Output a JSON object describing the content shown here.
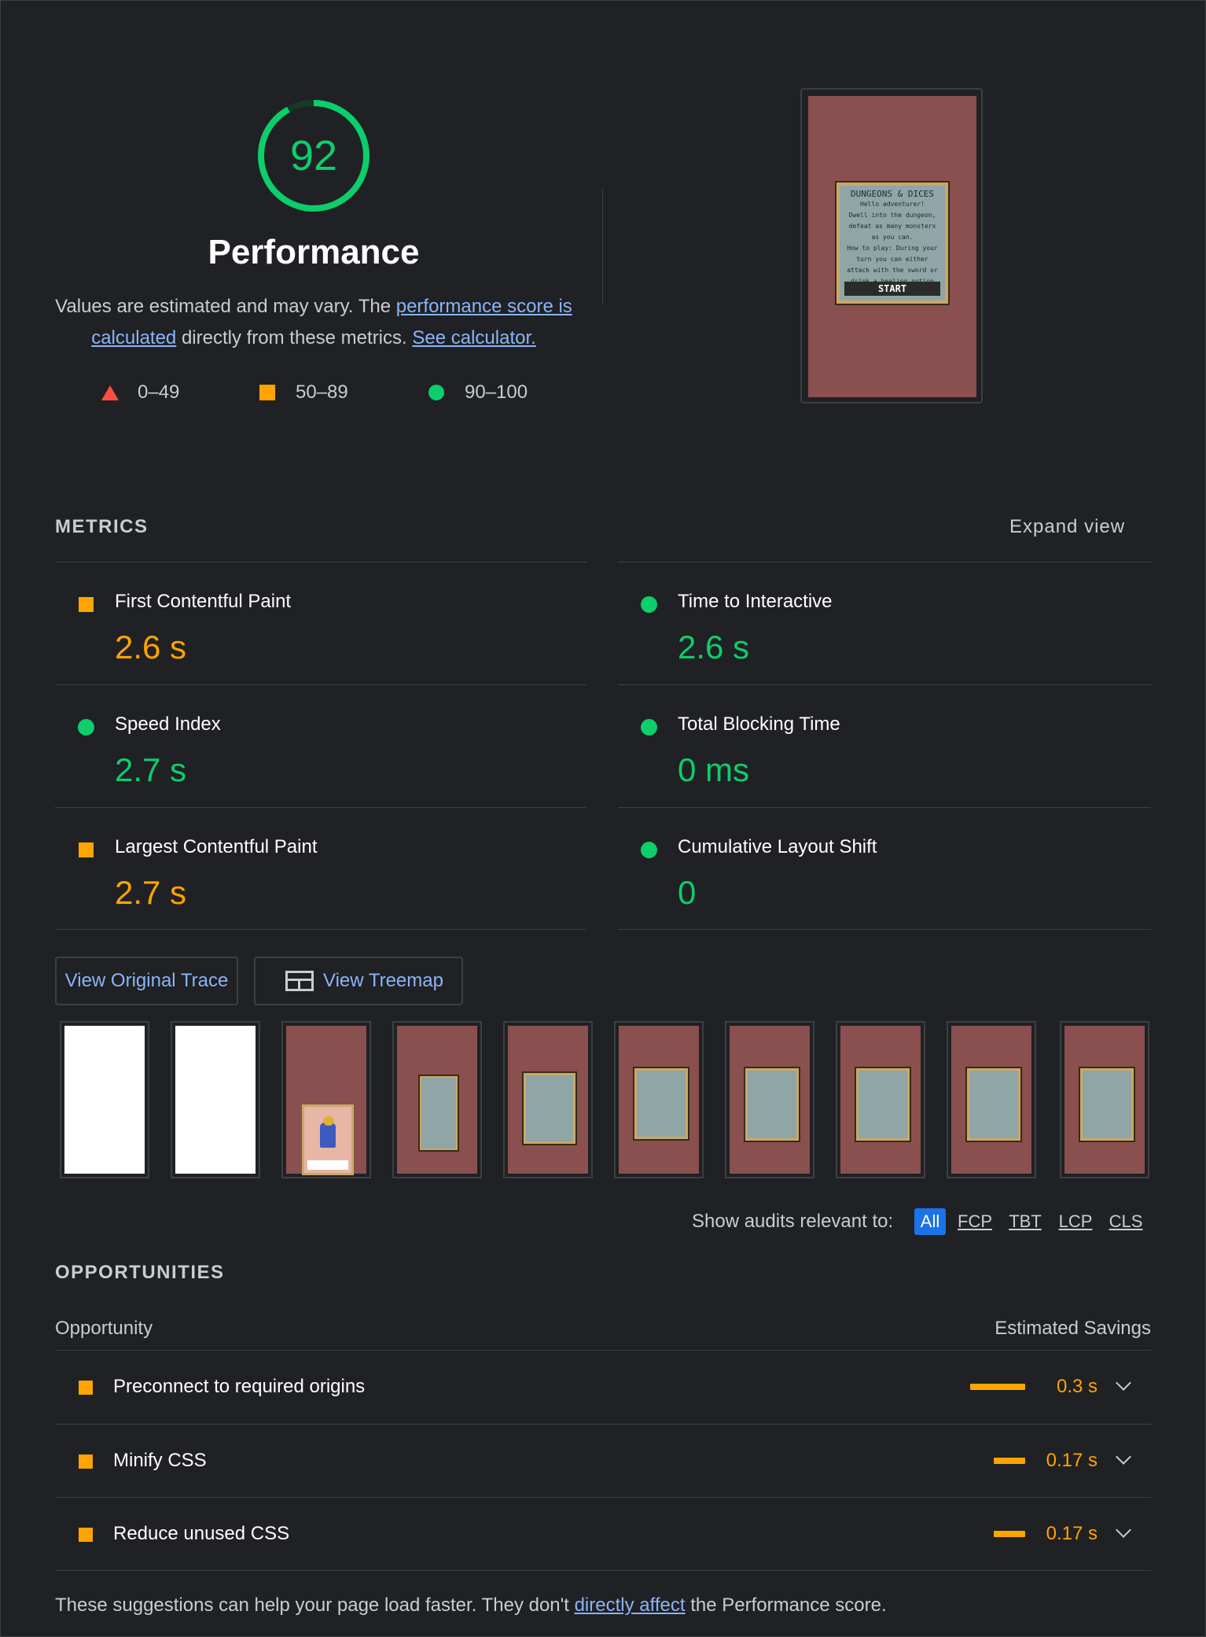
{
  "header": {
    "score": "92",
    "score_fraction": 0.92,
    "title": "Performance",
    "desc_prefix": "Values are estimated and may vary. The ",
    "desc_link1": "performance score is calculated",
    "desc_middle": " directly from these metrics. ",
    "desc_link2": "See calculator.",
    "scale": {
      "fail": "0–49",
      "average": "50–89",
      "pass": "90–100"
    }
  },
  "final_screenshot": {
    "game_title": "DUNGEONS & DICES",
    "lines": [
      "Hello adventurer!",
      "Dwell into the dungeon,",
      "defeat as many monsters",
      "as you can.",
      "How to play: During your",
      "turn you can either",
      "attack with the sword or",
      "drink a healing potion"
    ],
    "button": "START"
  },
  "metrics": {
    "section_label": "METRICS",
    "expand_label": "Expand view",
    "items": [
      {
        "name": "First Contentful Paint",
        "value": "2.6 s",
        "rating": "average"
      },
      {
        "name": "Time to Interactive",
        "value": "2.6 s",
        "rating": "pass"
      },
      {
        "name": "Speed Index",
        "value": "2.7 s",
        "rating": "pass"
      },
      {
        "name": "Total Blocking Time",
        "value": "0 ms",
        "rating": "pass"
      },
      {
        "name": "Largest Contentful Paint",
        "value": "2.7 s",
        "rating": "average"
      },
      {
        "name": "Cumulative Layout Shift",
        "value": "0",
        "rating": "pass"
      }
    ]
  },
  "buttons": {
    "trace": "View Original Trace",
    "treemap": "View Treemap"
  },
  "filter": {
    "label": "Show audits relevant to:",
    "chips": [
      "All",
      "FCP",
      "TBT",
      "LCP",
      "CLS"
    ],
    "active": "All"
  },
  "opportunities": {
    "section_label": "OPPORTUNITIES",
    "col_opportunity": "Opportunity",
    "col_savings": "Estimated Savings",
    "items": [
      {
        "title": "Preconnect to required origins",
        "savings": "0.3 s",
        "savings_fraction": 1.0
      },
      {
        "title": "Minify CSS",
        "savings": "0.17 s",
        "savings_fraction": 0.57
      },
      {
        "title": "Reduce unused CSS",
        "savings": "0.17 s",
        "savings_fraction": 0.57
      }
    ],
    "footer_prefix": "These suggestions can help your page load faster. They don't ",
    "footer_link": "directly affect",
    "footer_suffix": " the Performance score."
  },
  "colors": {
    "pass": "#0cce6b",
    "average": "#ffa400",
    "fail": "#ff4e42",
    "link": "#8ab4f8",
    "active_chip": "#1a73e8"
  }
}
